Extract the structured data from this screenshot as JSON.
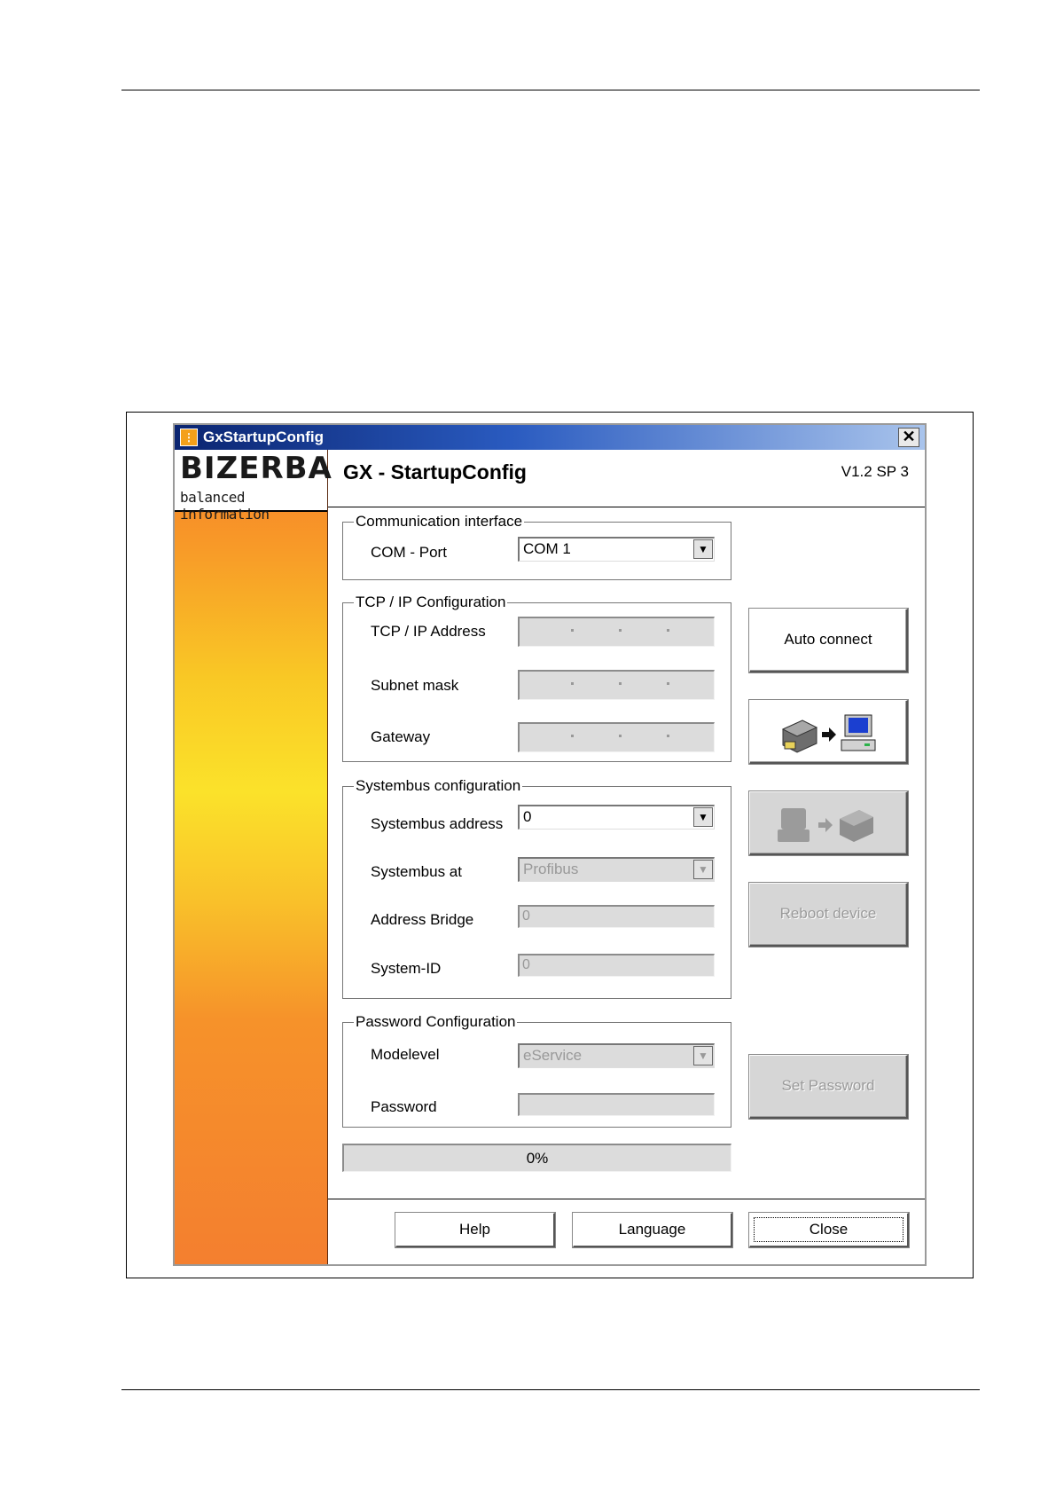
{
  "window": {
    "title": "GxStartupConfig",
    "close_glyph": "✕"
  },
  "brand": {
    "name": "BIZERBA",
    "tagline": "balanced information"
  },
  "header": {
    "title": "GX - StartupConfig",
    "version": "V1.2 SP 3"
  },
  "communication": {
    "legend": "Communication interface",
    "com_port_label": "COM - Port",
    "com_port_value": "COM 1"
  },
  "tcpip": {
    "legend": "TCP / IP Configuration",
    "address_label": "TCP / IP Address",
    "subnet_label": "Subnet mask",
    "gateway_label": "Gateway"
  },
  "systembus": {
    "legend": "Systembus configuration",
    "address_label": "Systembus address",
    "address_value": "0",
    "at_label": "Systembus at",
    "at_value": "Profibus",
    "bridge_label": "Address Bridge",
    "bridge_value": "0",
    "system_id_label": "System-ID",
    "system_id_value": "0"
  },
  "password": {
    "legend": "Password Configuration",
    "modelevel_label": "Modelevel",
    "modelevel_value": "eService",
    "password_label": "Password",
    "password_value": ""
  },
  "progress": {
    "text": "0%",
    "fraction": 0
  },
  "side_buttons": {
    "auto_connect": "Auto connect",
    "upload_icon": "device-to-pc-icon",
    "download_icon": "pc-to-device-icon",
    "reboot": "Reboot device",
    "set_password": "Set Password"
  },
  "footer": {
    "help": "Help",
    "language": "Language",
    "close": "Close"
  },
  "colors": {
    "titlebar_start": "#0a2470",
    "titlebar_end": "#a9c4ec",
    "sidebar_orange": "#f47f2f",
    "sidebar_yellow": "#fbe22a"
  }
}
